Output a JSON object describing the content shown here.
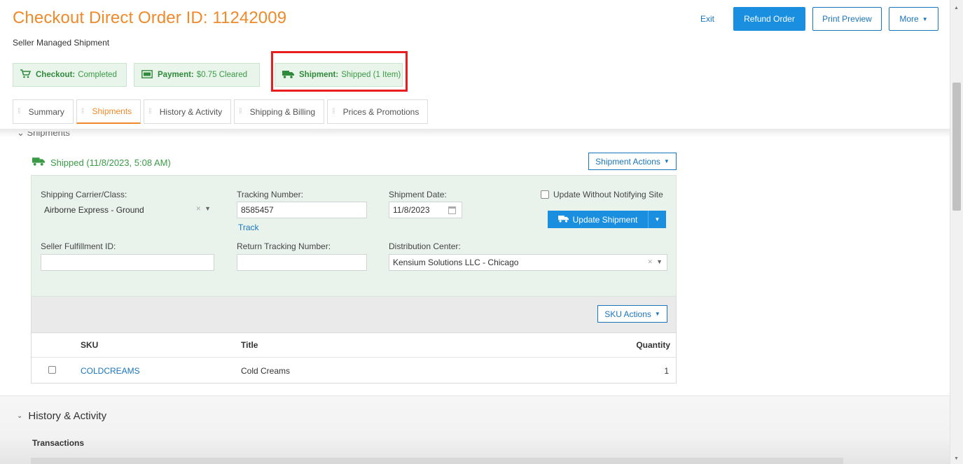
{
  "header": {
    "title": "Checkout Direct Order ID: 11242009",
    "subtitle": "Seller Managed Shipment",
    "exit_label": "Exit",
    "refund_label": "Refund Order",
    "print_label": "Print Preview",
    "more_label": "More"
  },
  "badges": {
    "checkout": {
      "label": "Checkout:",
      "value": "Completed",
      "icon": "cart-icon"
    },
    "payment": {
      "label": "Payment:",
      "value": "$0.75 Cleared",
      "icon": "payment-card-icon"
    },
    "shipment": {
      "label": "Shipment:",
      "value": "Shipped (1 Item)",
      "icon": "truck-icon"
    }
  },
  "tabs": [
    {
      "label": "Summary"
    },
    {
      "label": "Shipments"
    },
    {
      "label": "History & Activity"
    },
    {
      "label": "Shipping & Billing"
    },
    {
      "label": "Prices & Promotions"
    }
  ],
  "active_tab": "Shipments",
  "shipments": {
    "section_heading": "Shipments",
    "status": "Shipped (11/8/2023, 5:08 AM)",
    "actions_label": "Shipment Actions",
    "carrier_label": "Shipping Carrier/Class:",
    "carrier_value": "Airborne Express - Ground",
    "tracking_label": "Tracking Number:",
    "tracking_value": "8585457",
    "track_link": "Track",
    "date_label": "Shipment Date:",
    "date_value": "11/8/2023",
    "notify_label": "Update Without Notifying Site",
    "update_label": "Update Shipment",
    "fulfillment_label": "Seller Fulfillment ID:",
    "fulfillment_value": "",
    "return_label": "Return Tracking Number:",
    "return_value": "",
    "dc_label": "Distribution Center:",
    "dc_value": "Kensium Solutions LLC - Chicago",
    "sku_actions_label": "SKU Actions"
  },
  "sku_table": {
    "columns": [
      "SKU",
      "Title",
      "Quantity"
    ],
    "rows": [
      {
        "sku": "COLDCREAMS",
        "title": "Cold Creams",
        "quantity": "1"
      }
    ]
  },
  "history": {
    "title": "History & Activity",
    "transactions_label": "Transactions"
  },
  "colors": {
    "title_orange": "#ef8a2b",
    "primary_blue": "#1a8fe0",
    "success_green": "#3a9b46",
    "highlight_red": "#e81d1d"
  }
}
